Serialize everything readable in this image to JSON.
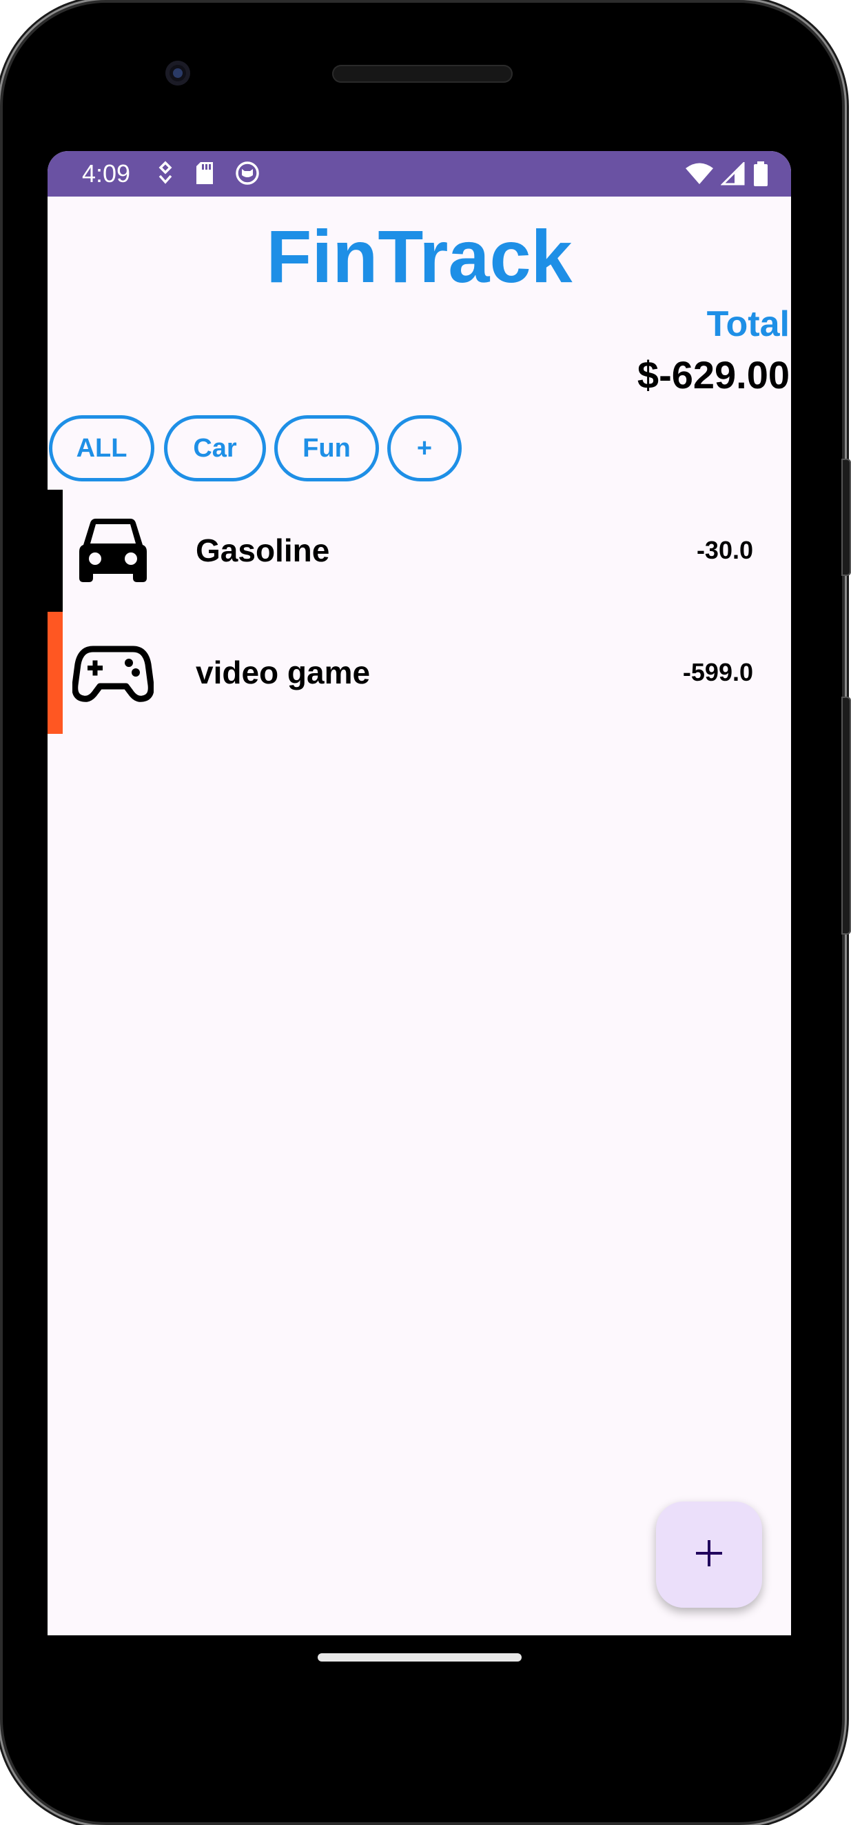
{
  "status_bar": {
    "time": "4:09",
    "left_icons": [
      "location-pin-icon",
      "sd-card-icon",
      "cat-face-icon"
    ],
    "right_icons": [
      "wifi-icon",
      "cell-signal-icon",
      "battery-icon"
    ],
    "color": "#6a52a3"
  },
  "header": {
    "title": "FinTrack",
    "total_label": "Total",
    "total_value": "$-629.00",
    "accent_color": "#1e8fe6"
  },
  "chips": [
    {
      "label": "ALL"
    },
    {
      "label": "Car"
    },
    {
      "label": "Fun"
    },
    {
      "label": "+"
    }
  ],
  "expenses": [
    {
      "name": "Gasoline",
      "amount": "-30.0",
      "icon": "car-icon",
      "stripe_color": "#000000"
    },
    {
      "name": "video game",
      "amount": "-599.0",
      "icon": "gamepad-icon",
      "stripe_color": "#ff5722"
    }
  ],
  "fab": {
    "icon": "plus-icon",
    "background": "#ebdffa"
  }
}
